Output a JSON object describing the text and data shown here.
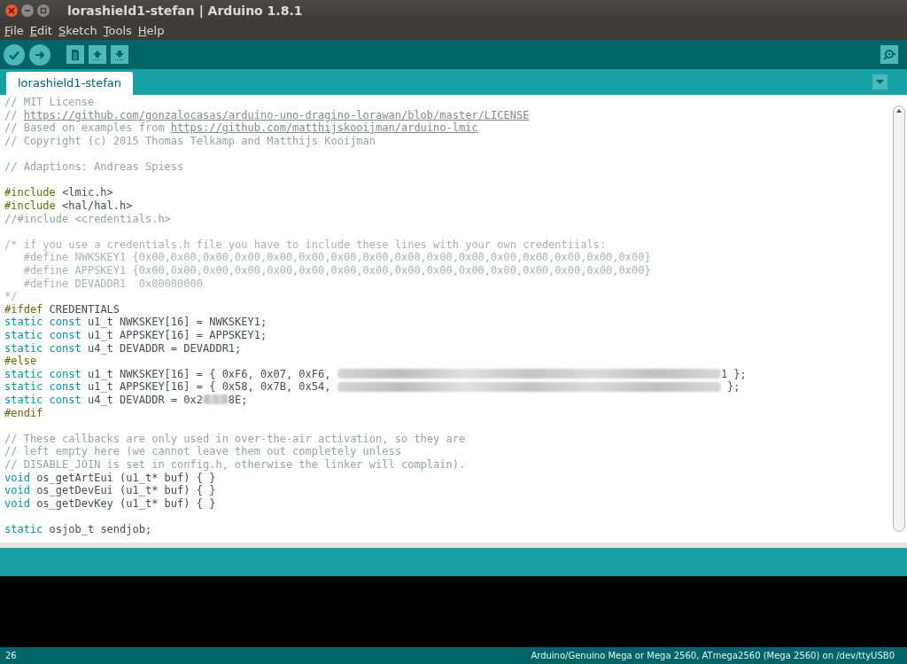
{
  "window": {
    "title": "lorashield1-stefan | Arduino 1.8.1"
  },
  "menu": [
    "File",
    "Edit",
    "Sketch",
    "Tools",
    "Help"
  ],
  "tabs": [
    {
      "label": "lorashield1-stefan",
      "selected": true
    }
  ],
  "code": [
    {
      "kind": "code",
      "segments": [
        {
          "kind": "comment",
          "text": "// MIT License"
        }
      ]
    },
    {
      "kind": "code",
      "segments": [
        {
          "kind": "comment",
          "text": "// "
        },
        {
          "kind": "link",
          "text": "https://github.com/gonzalocasas/arduino-uno-dragino-lorawan/blob/master/LICENSE"
        }
      ]
    },
    {
      "kind": "code",
      "segments": [
        {
          "kind": "comment",
          "text": "// Based on examples from "
        },
        {
          "kind": "link",
          "text": "https://github.com/matthijskooijman/arduino-lmic"
        }
      ]
    },
    {
      "kind": "code",
      "segments": [
        {
          "kind": "comment",
          "text": "// Copyright (c) 2015 Thomas Telkamp and Matthijs Kooijman"
        }
      ]
    },
    {
      "kind": "blank"
    },
    {
      "kind": "code",
      "segments": [
        {
          "kind": "comment",
          "text": "// Adaptions: Andreas Spiess"
        }
      ]
    },
    {
      "kind": "blank"
    },
    {
      "kind": "code",
      "segments": [
        {
          "kind": "preproc",
          "text": "#include"
        },
        {
          "kind": "plain",
          "text": " <lmic.h>"
        }
      ]
    },
    {
      "kind": "code",
      "segments": [
        {
          "kind": "preproc",
          "text": "#include"
        },
        {
          "kind": "plain",
          "text": " <hal/hal.h>"
        }
      ]
    },
    {
      "kind": "code",
      "segments": [
        {
          "kind": "comment",
          "text": "//#include <credentials.h>"
        }
      ]
    },
    {
      "kind": "blank"
    },
    {
      "kind": "code",
      "segments": [
        {
          "kind": "blockcomment",
          "text": "/* if you use a credentials.h file you have to include these lines with your own credentiials:"
        }
      ]
    },
    {
      "kind": "code",
      "segments": [
        {
          "kind": "blockcomment",
          "text": "   #define NWKSKEY1 {0x00,0x00,0x00,0x00,0x00,0x00,0x00,0x00,0x00,0x00,0x00,0x00,0x00,0x00,0x00,0x00}"
        }
      ]
    },
    {
      "kind": "code",
      "segments": [
        {
          "kind": "blockcomment",
          "text": "   #define APPSKEY1 {0x00,0x00,0x00,0x00,0x00,0x00,0x00,0x00,0x00,0x00,0x00,0x00,0x00,0x00,0x00,0x00}"
        }
      ]
    },
    {
      "kind": "code",
      "segments": [
        {
          "kind": "blockcomment",
          "text": "   #define DEVADDR1  0x00000000"
        }
      ]
    },
    {
      "kind": "code",
      "segments": [
        {
          "kind": "blockcomment",
          "text": "*/"
        }
      ]
    },
    {
      "kind": "code",
      "segments": [
        {
          "kind": "preproc",
          "text": "#ifdef"
        },
        {
          "kind": "plain",
          "text": " CREDENTIALS"
        }
      ]
    },
    {
      "kind": "code",
      "segments": [
        {
          "kind": "keyword",
          "text": "static const"
        },
        {
          "kind": "plain",
          "text": " u1_t NWKSKEY[16] = NWKSKEY1;"
        }
      ]
    },
    {
      "kind": "code",
      "segments": [
        {
          "kind": "keyword",
          "text": "static const"
        },
        {
          "kind": "plain",
          "text": " u1_t APPSKEY[16] = APPSKEY1;"
        }
      ]
    },
    {
      "kind": "code",
      "segments": [
        {
          "kind": "keyword",
          "text": "static const"
        },
        {
          "kind": "plain",
          "text": " u4_t DEVADDR = DEVADDR1;"
        }
      ]
    },
    {
      "kind": "code",
      "segments": [
        {
          "kind": "preproc",
          "text": "#else"
        }
      ]
    },
    {
      "kind": "code",
      "segments": [
        {
          "kind": "keyword",
          "text": "static const"
        },
        {
          "kind": "plain",
          "text": " u1_t NWKSKEY[16] = { 0xF6, 0x07, 0xF6, "
        },
        {
          "kind": "blurlong"
        },
        {
          "kind": "plain",
          "text": "1 };"
        }
      ]
    },
    {
      "kind": "code",
      "segments": [
        {
          "kind": "keyword",
          "text": "static const"
        },
        {
          "kind": "plain",
          "text": " u1_t APPSKEY[16] = { 0x58, 0x7B, 0x54, "
        },
        {
          "kind": "blurlong"
        },
        {
          "kind": "plain",
          "text": " };"
        }
      ]
    },
    {
      "kind": "code",
      "segments": [
        {
          "kind": "keyword",
          "text": "static const"
        },
        {
          "kind": "plain",
          "text": " u4_t DEVADDR = 0x2"
        },
        {
          "kind": "blurshort"
        },
        {
          "kind": "plain",
          "text": "8E;"
        }
      ]
    },
    {
      "kind": "code",
      "segments": [
        {
          "kind": "preproc",
          "text": "#endif"
        }
      ]
    },
    {
      "kind": "blank"
    },
    {
      "kind": "code",
      "segments": [
        {
          "kind": "comment",
          "text": "// These callbacks are only used in over-the-air activation, so they are"
        }
      ]
    },
    {
      "kind": "code",
      "segments": [
        {
          "kind": "comment",
          "text": "// left empty here (we cannot leave them out completely unless"
        }
      ]
    },
    {
      "kind": "code",
      "segments": [
        {
          "kind": "comment",
          "text": "// DISABLE_JOIN is set in config.h, otherwise the linker will complain)."
        }
      ]
    },
    {
      "kind": "code",
      "segments": [
        {
          "kind": "keyword",
          "text": "void"
        },
        {
          "kind": "plain",
          "text": " os_getArtEui (u1_t* buf) { }"
        }
      ]
    },
    {
      "kind": "code",
      "segments": [
        {
          "kind": "keyword",
          "text": "void"
        },
        {
          "kind": "plain",
          "text": " os_getDevEui (u1_t* buf) { }"
        }
      ]
    },
    {
      "kind": "code",
      "segments": [
        {
          "kind": "keyword",
          "text": "void"
        },
        {
          "kind": "plain",
          "text": " os_getDevKey (u1_t* buf) { }"
        }
      ]
    },
    {
      "kind": "blank"
    },
    {
      "kind": "code",
      "segments": [
        {
          "kind": "keyword",
          "text": "static"
        },
        {
          "kind": "plain",
          "text": " osjob_t sendjob;"
        }
      ]
    }
  ],
  "status_bar": {
    "line": "26",
    "board": "Arduino/Genuino Mega or Mega 2560, ATmega2560 (Mega 2560) on /dev/ttyUSB0"
  }
}
